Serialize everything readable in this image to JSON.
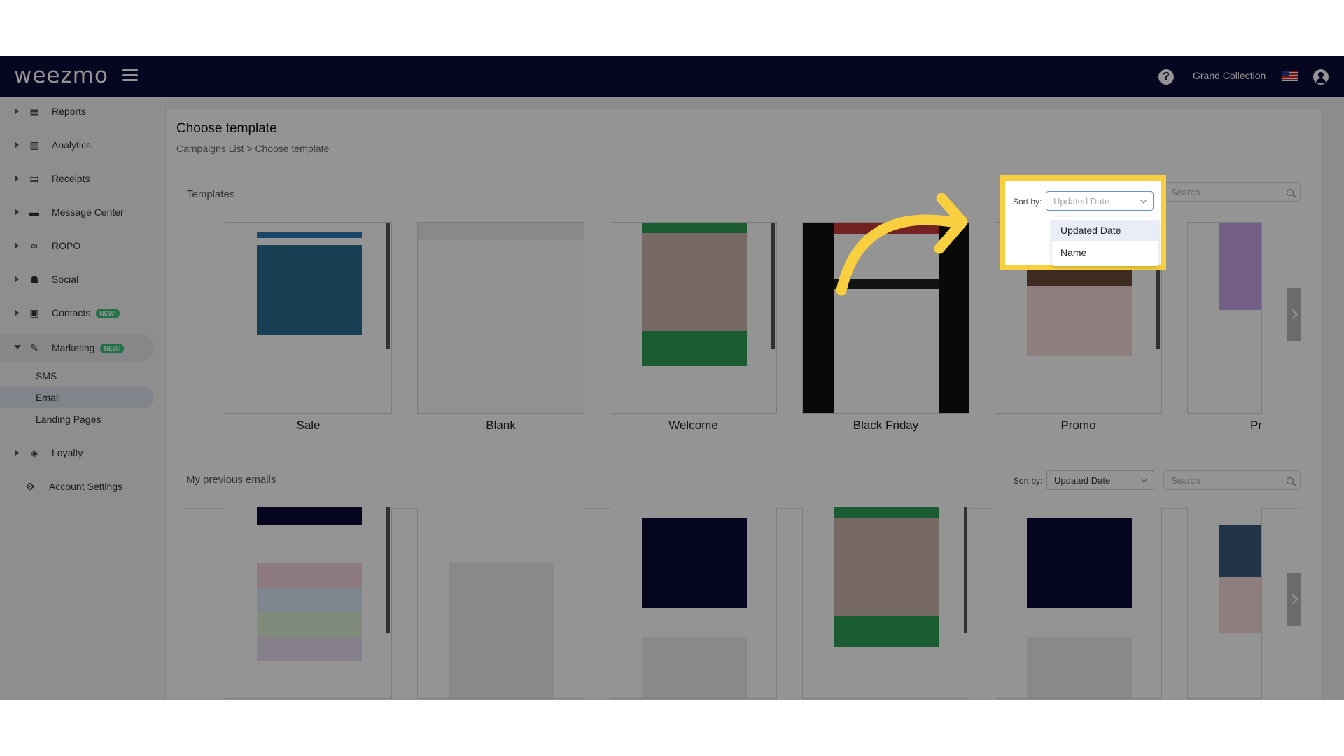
{
  "app": {
    "logo": "weezmo",
    "store_name": "Grand Collection"
  },
  "sidebar": {
    "items": [
      {
        "label": "Reports",
        "icon": "dashboard-icon"
      },
      {
        "label": "Analytics",
        "icon": "chart-icon"
      },
      {
        "label": "Receipts",
        "icon": "receipt-icon"
      },
      {
        "label": "Message Center",
        "icon": "message-icon"
      },
      {
        "label": "ROPO",
        "icon": "infinity-icon"
      },
      {
        "label": "Social",
        "icon": "people-icon"
      },
      {
        "label": "Contacts",
        "icon": "contacts-icon",
        "badge": "NEW!"
      },
      {
        "label": "Marketing",
        "icon": "megaphone-icon",
        "badge": "NEW!"
      },
      {
        "label": "Loyalty",
        "icon": "tag-icon"
      },
      {
        "label": "Account Settings",
        "icon": "gear-icon"
      }
    ],
    "marketing_sub": [
      "SMS",
      "Email",
      "Landing Pages"
    ]
  },
  "page": {
    "title": "Choose template",
    "breadcrumb": "Campaigns List  >  Choose template"
  },
  "templates": {
    "section_title": "Templates",
    "sort_label": "Sort by:",
    "sort_value": "Updated Date",
    "search_placeholder": "Search",
    "cards": [
      "Sale",
      "Blank",
      "Welcome",
      "Black Friday",
      "Promo",
      "Pr"
    ]
  },
  "sort_dropdown": {
    "options": [
      "Updated Date",
      "Name"
    ],
    "selected": "Updated Date"
  },
  "previous": {
    "section_title": "My previous emails",
    "sort_label": "Sort by:",
    "sort_value": "Updated Date",
    "search_placeholder": "Search"
  },
  "colors": {
    "topbar": "#0b0c3a",
    "highlight": "#f7cf3f",
    "accent_green": "#39c27a"
  }
}
